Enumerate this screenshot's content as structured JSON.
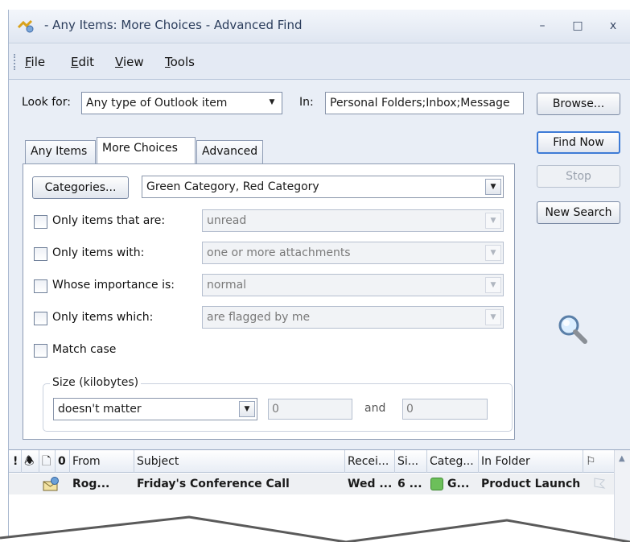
{
  "window": {
    "title": "- Any Items: More Choices - Advanced Find",
    "controls": {
      "minimize": "–",
      "maximize": "□",
      "close": "x"
    }
  },
  "menu": {
    "items": [
      {
        "label": "File",
        "key": "F",
        "rest": "ile"
      },
      {
        "label": "Edit",
        "key": "E",
        "rest": "dit"
      },
      {
        "label": "View",
        "key": "V",
        "rest": "iew"
      },
      {
        "label": "Tools",
        "key": "T",
        "rest": "ools"
      }
    ]
  },
  "search": {
    "look_for_label": "Look for:",
    "look_for_value": "Any type of Outlook item",
    "in_label": "In:",
    "in_value": "Personal Folders;Inbox;Message",
    "browse_label": "Browse..."
  },
  "tabs": [
    {
      "label": "Any Items",
      "active": false
    },
    {
      "label": "More Choices",
      "active": true
    },
    {
      "label": "Advanced",
      "active": false
    }
  ],
  "actions": {
    "find_now": "Find Now",
    "stop": "Stop",
    "new_search": "New Search"
  },
  "more_choices": {
    "categories_button": "Categories...",
    "categories_value": "Green Category, Red Category",
    "options": [
      {
        "label": "Only items that are:",
        "value": "unread",
        "checked": false
      },
      {
        "label": "Only items with:",
        "value": "one or more attachments",
        "checked": false
      },
      {
        "label": "Whose importance is:",
        "value": "normal",
        "checked": false
      },
      {
        "label": "Only items which:",
        "value": "are flagged by me",
        "checked": false
      }
    ],
    "match_case_label": "Match case",
    "size": {
      "group_label": "Size (kilobytes)",
      "condition": "doesn't matter",
      "from": "0",
      "and_label": "and",
      "to": "0"
    }
  },
  "results": {
    "columns": {
      "importance": "!",
      "reminder": "🕭",
      "icon": "🗋",
      "attachment": "0",
      "from": "From",
      "subject": "Subject",
      "received": "Recei...",
      "size": "Si...",
      "categories": "Categ...",
      "in_folder": "In Folder",
      "flag": "⚐"
    },
    "rows": [
      {
        "from": "Rog...",
        "subject": "Friday's Conference Call",
        "received": "Wed ...",
        "size": "6 ...",
        "category": "G...",
        "category_color": "#6cbf5a",
        "in_folder": "Product Launch"
      }
    ]
  },
  "colors": {
    "accent": "#3e7bd6",
    "window_bg": "#e9eef6",
    "category_green": "#6cbf5a"
  }
}
